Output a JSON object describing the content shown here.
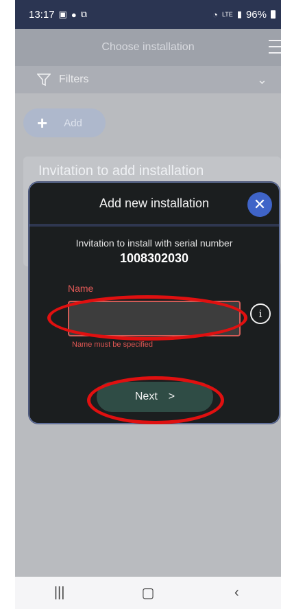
{
  "status": {
    "time": "13:17",
    "left_icons": [
      "image-icon",
      "chat-icon",
      "screen-icon"
    ],
    "right_icons": [
      "wifi-icon",
      "volte-icon",
      "signal-icon"
    ],
    "battery": "96%"
  },
  "header": {
    "title": "Choose installation"
  },
  "filters": {
    "label": "Filters"
  },
  "add": {
    "label": "Add"
  },
  "background": {
    "card_title": "Invitation to add installation"
  },
  "modal": {
    "title": "Add new installation",
    "invite_text": "Invitation to install with serial number",
    "serial": "1008302030",
    "name_label": "Name",
    "name_value": "",
    "name_error": "Name must be specified",
    "next_label": "Next"
  },
  "colors": {
    "accent": "#3f64c8",
    "error": "#e25a57",
    "annotation": "#e01010",
    "next_button": "#2f4c45"
  }
}
